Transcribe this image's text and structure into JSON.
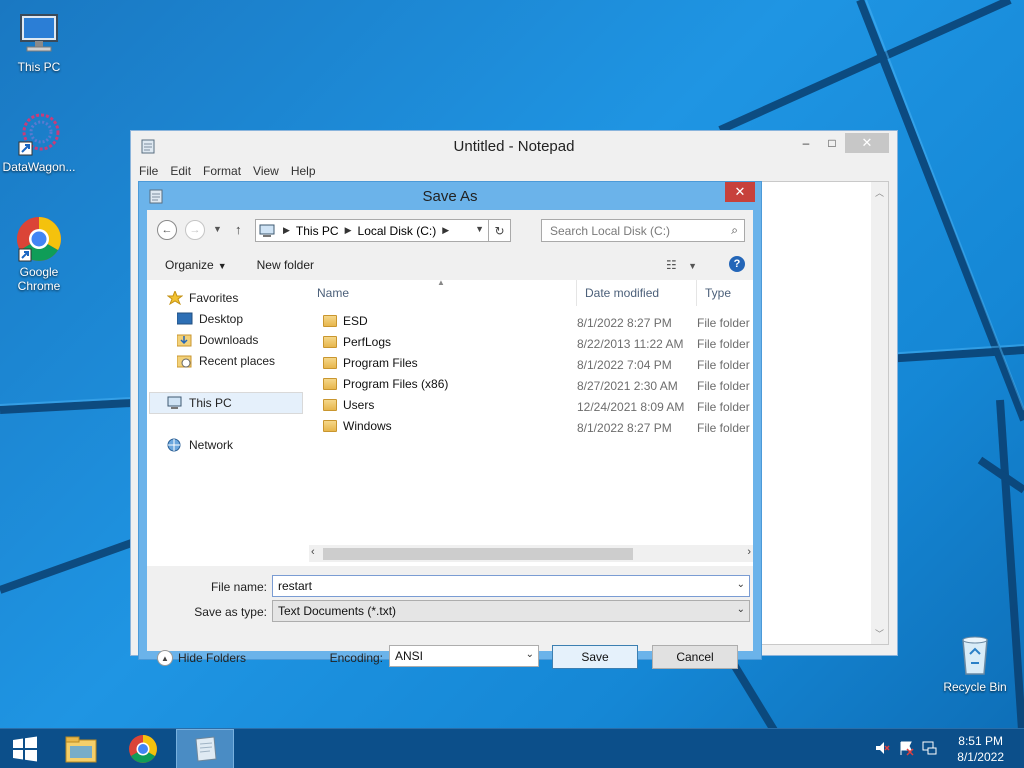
{
  "desktop": {
    "icons": [
      {
        "label": "This PC",
        "icon": "this-pc-icon"
      },
      {
        "label": "DataWagon...",
        "icon": "datawagon-icon"
      },
      {
        "label": "Google Chrome",
        "icon": "chrome-icon"
      },
      {
        "label": "Recycle Bin",
        "icon": "recycle-bin-icon"
      }
    ]
  },
  "notepad": {
    "title": "Untitled - Notepad",
    "menu": [
      "File",
      "Edit",
      "Format",
      "View",
      "Help"
    ],
    "controls": {
      "minimize": "–",
      "maximize": "□",
      "close": "✕"
    }
  },
  "save_as": {
    "title": "Save As",
    "close": "✕",
    "address": {
      "segments": [
        "This PC",
        "Local Disk (C:)"
      ]
    },
    "search_placeholder": "Search Local Disk (C:)",
    "toolbar": {
      "organize": "Organize",
      "new_folder": "New folder"
    },
    "nav_pane": {
      "favorites": "Favorites",
      "favorites_items": [
        "Desktop",
        "Downloads",
        "Recent places"
      ],
      "this_pc": "This PC",
      "network": "Network"
    },
    "columns": [
      "Name",
      "Date modified",
      "Type"
    ],
    "files": [
      {
        "name": "ESD",
        "date": "8/1/2022 8:27 PM",
        "type": "File folder"
      },
      {
        "name": "PerfLogs",
        "date": "8/22/2013 11:22 AM",
        "type": "File folder"
      },
      {
        "name": "Program Files",
        "date": "8/1/2022 7:04 PM",
        "type": "File folder"
      },
      {
        "name": "Program Files (x86)",
        "date": "8/27/2021 2:30 AM",
        "type": "File folder"
      },
      {
        "name": "Users",
        "date": "12/24/2021 8:09 AM",
        "type": "File folder"
      },
      {
        "name": "Windows",
        "date": "8/1/2022 8:27 PM",
        "type": "File folder"
      }
    ],
    "file_name_label": "File name:",
    "file_name_value": "restart",
    "save_type_label": "Save as type:",
    "save_type_value": "Text Documents (*.txt)",
    "hide_folders": "Hide Folders",
    "encoding_label": "Encoding:",
    "encoding_value": "ANSI",
    "save_button": "Save",
    "cancel_button": "Cancel"
  },
  "taskbar": {
    "time": "8:51 PM",
    "date": "8/1/2022"
  },
  "colors": {
    "desktop": "#1a8fd8",
    "taskbar": "#0c4f8a",
    "dialog_frame": "#6bb3ea",
    "close_red": "#c7413c"
  }
}
